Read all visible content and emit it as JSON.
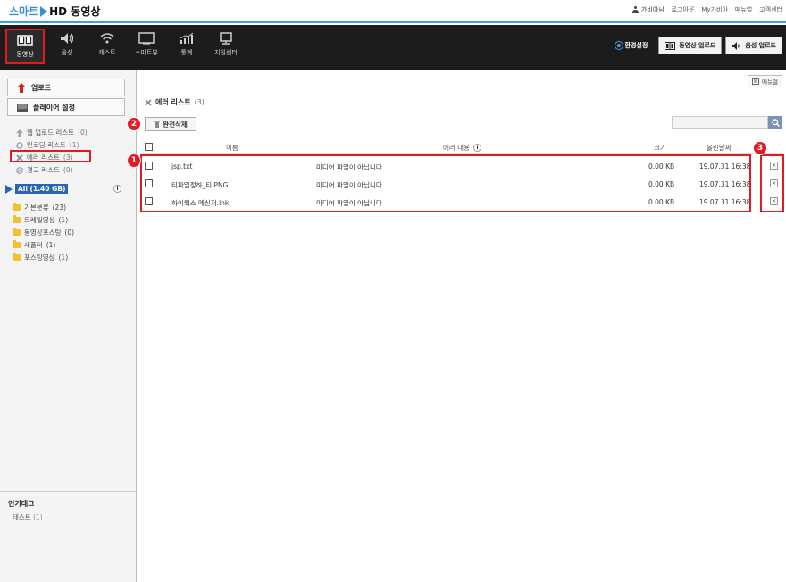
{
  "app": {
    "logo_smart": "스마트",
    "logo_hd": "HD 동영상"
  },
  "toplinks": {
    "user": "가비아님",
    "logout": "로그아웃",
    "mygabia": "My가비아",
    "manual": "매뉴얼",
    "support": "고객센터"
  },
  "nav": {
    "items": [
      {
        "label": "동영상"
      },
      {
        "label": "음성"
      },
      {
        "label": "캐스트"
      },
      {
        "label": "스마트뷰"
      },
      {
        "label": "통계"
      },
      {
        "label": "지원센터"
      }
    ],
    "env_settings": "환경설정",
    "video_upload": "동영상 업로드",
    "audio_upload": "음성 업로드"
  },
  "sidebar": {
    "upload": "업로드",
    "player_settings": "플레이어 설정",
    "lists": [
      {
        "label": "웹 업로드 리스트",
        "count": "(0)"
      },
      {
        "label": "인코딩 리스트",
        "count": "(1)"
      },
      {
        "label": "에러 리스트",
        "count": "(3)"
      },
      {
        "label": "경고 리스트",
        "count": "(0)"
      }
    ],
    "all_label": "All (1.40 GB)",
    "info": "i",
    "folders": [
      {
        "label": "기본분류",
        "count": "(23)"
      },
      {
        "label": "트레일영상",
        "count": "(1)"
      },
      {
        "label": "동영상포스팅",
        "count": "(0)"
      },
      {
        "label": "새폴더",
        "count": "(1)"
      },
      {
        "label": "포스팅영상",
        "count": "(1)"
      }
    ],
    "tags_title": "인기태그",
    "tags": [
      {
        "label": "테스트",
        "count": "(1)"
      }
    ]
  },
  "main": {
    "manual_btn": "매뉴얼",
    "crumb_title": "에러 리스트",
    "crumb_count": "(3)",
    "delete_all": "완전삭제",
    "search_placeholder": "",
    "headers": {
      "name": "이름",
      "error": "에러 내용",
      "size": "크기",
      "date": "올린날짜"
    },
    "rows": [
      {
        "name": "jsp.txt",
        "error": "미디어 파일이 아닙니다",
        "size": "0.00 KB",
        "date": "19.07.31 16:38"
      },
      {
        "name": "티파일정하_티.PNG",
        "error": "미디어 파일이 아닙니다",
        "size": "0.00 KB",
        "date": "19.07.31 16:38"
      },
      {
        "name": "하이웍스 메신저.lnk",
        "error": "미디어 파일이 아닙니다",
        "size": "0.00 KB",
        "date": "19.07.31 16:38"
      }
    ],
    "delete_glyph": "×"
  },
  "annotations": {
    "badge1": "1",
    "badge2": "2",
    "badge3": "3"
  },
  "colors": {
    "accent": "#3aa0e0",
    "highlight": "#e01b24",
    "nav_bg": "#1c1c1c"
  }
}
